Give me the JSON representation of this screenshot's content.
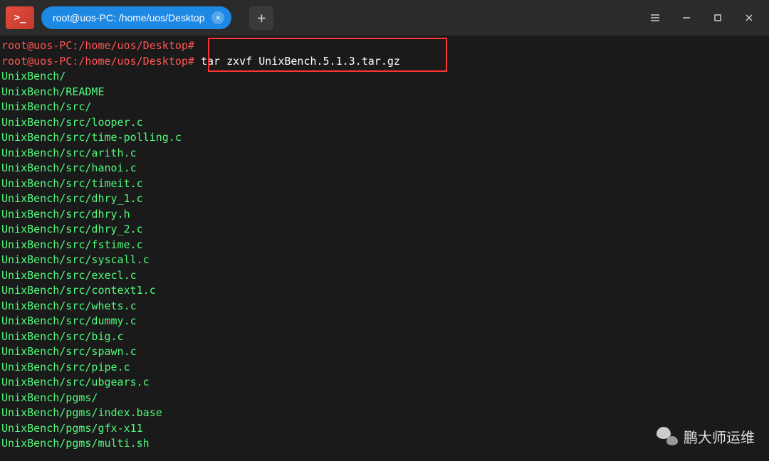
{
  "titlebar": {
    "tab_title": "root@uos-PC: /home/uos/Desktop",
    "app_icon_text": ">_"
  },
  "terminal": {
    "lines": [
      {
        "prompt": "root@uos-PC:/home/uos/Desktop#",
        "command": ""
      },
      {
        "prompt": "root@uos-PC:/home/uos/Desktop#",
        "command": " tar zxvf UnixBench.5.1.3.tar.gz"
      },
      {
        "output": "UnixBench/"
      },
      {
        "output": "UnixBench/README"
      },
      {
        "output": "UnixBench/src/"
      },
      {
        "output": "UnixBench/src/looper.c"
      },
      {
        "output": "UnixBench/src/time-polling.c"
      },
      {
        "output": "UnixBench/src/arith.c"
      },
      {
        "output": "UnixBench/src/hanoi.c"
      },
      {
        "output": "UnixBench/src/timeit.c"
      },
      {
        "output": "UnixBench/src/dhry_1.c"
      },
      {
        "output": "UnixBench/src/dhry.h"
      },
      {
        "output": "UnixBench/src/dhry_2.c"
      },
      {
        "output": "UnixBench/src/fstime.c"
      },
      {
        "output": "UnixBench/src/syscall.c"
      },
      {
        "output": "UnixBench/src/execl.c"
      },
      {
        "output": "UnixBench/src/context1.c"
      },
      {
        "output": "UnixBench/src/whets.c"
      },
      {
        "output": "UnixBench/src/dummy.c"
      },
      {
        "output": "UnixBench/src/big.c"
      },
      {
        "output": "UnixBench/src/spawn.c"
      },
      {
        "output": "UnixBench/src/pipe.c"
      },
      {
        "output": "UnixBench/src/ubgears.c"
      },
      {
        "output": "UnixBench/pgms/"
      },
      {
        "output": "UnixBench/pgms/index.base"
      },
      {
        "output": "UnixBench/pgms/gfx-x11"
      },
      {
        "output": "UnixBench/pgms/multi.sh"
      }
    ]
  },
  "watermark": {
    "text": "鹏大师运维"
  }
}
